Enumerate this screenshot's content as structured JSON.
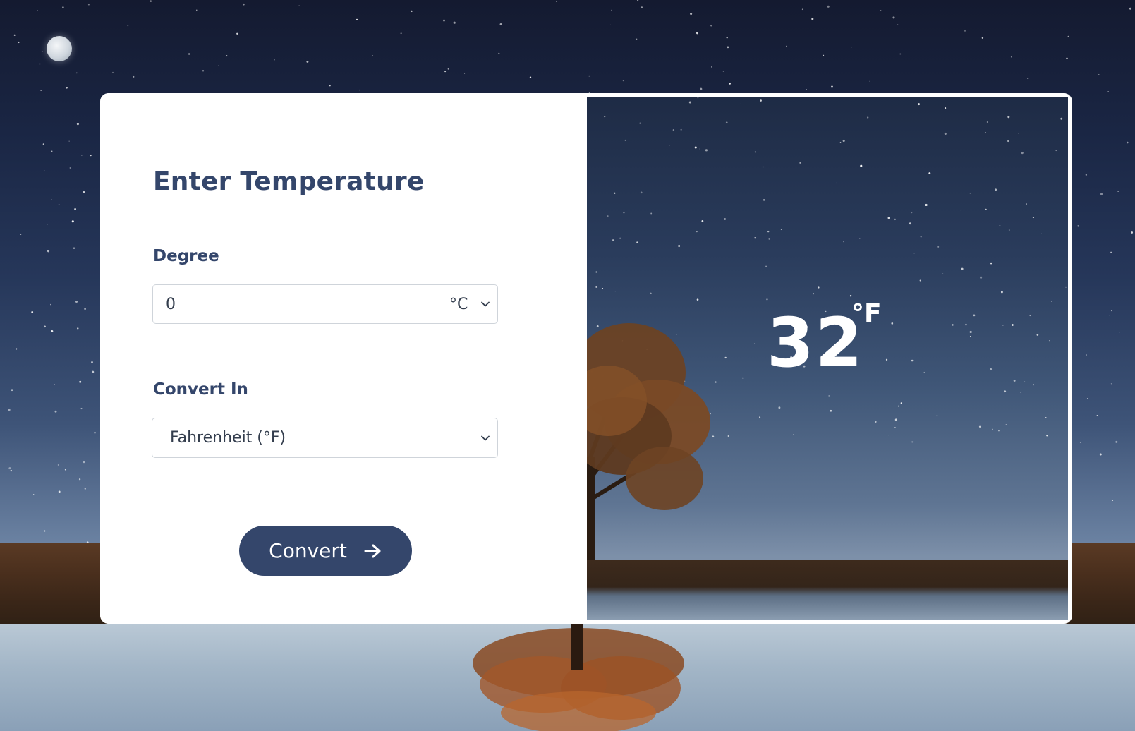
{
  "form": {
    "title": "Enter Temperature",
    "degree_label": "Degree",
    "degree_value": "0",
    "degree_unit": "°C",
    "convert_label": "Convert In",
    "convert_value": "Fahrenheit (°F)",
    "convert_button": "Convert"
  },
  "result": {
    "value": "32",
    "unit": "°F"
  },
  "icons": {
    "degree_unit_chevron": "chevron-down-icon",
    "convert_select_chevron": "chevron-down-icon",
    "convert_arrow": "arrow-right-icon"
  },
  "colors": {
    "accent": "#34466b",
    "card_bg": "#ffffff",
    "result_text": "#ffffff"
  }
}
